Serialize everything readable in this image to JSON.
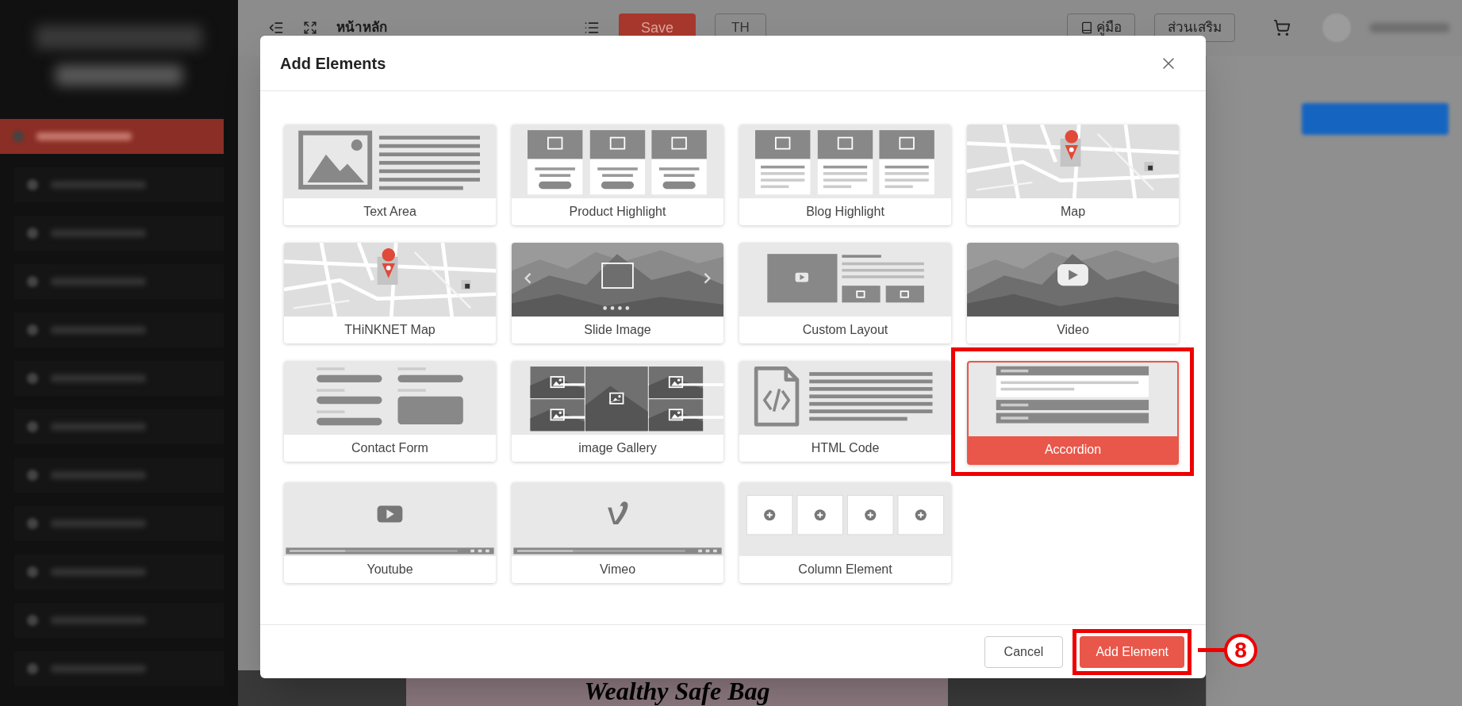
{
  "topbar": {
    "page_title": "หน้าหลัก",
    "save": "Save",
    "language": "TH",
    "manual": "คู่มือ",
    "addons": "ส่วนเสริม"
  },
  "sidebar": {
    "items": [
      {
        "selected": true
      },
      {
        "selected": false
      },
      {
        "selected": false
      },
      {
        "selected": false
      },
      {
        "selected": false
      },
      {
        "selected": false
      },
      {
        "selected": false
      },
      {
        "selected": false
      },
      {
        "selected": false
      },
      {
        "selected": false
      },
      {
        "selected": false
      },
      {
        "selected": false
      }
    ]
  },
  "canvas": {
    "banner": "Wealthy Safe Bag"
  },
  "modal": {
    "title": "Add Elements",
    "elements": [
      {
        "label": "Text Area",
        "kind": "text-area",
        "selected": false
      },
      {
        "label": "Product Highlight",
        "kind": "product-highlight",
        "selected": false
      },
      {
        "label": "Blog Highlight",
        "kind": "blog-highlight",
        "selected": false
      },
      {
        "label": "Map",
        "kind": "map",
        "selected": false
      },
      {
        "label": "THiNKNET Map",
        "kind": "map",
        "selected": false
      },
      {
        "label": "Slide Image",
        "kind": "slide",
        "selected": false
      },
      {
        "label": "Custom Layout",
        "kind": "custom-layout",
        "selected": false
      },
      {
        "label": "Video",
        "kind": "video",
        "selected": false
      },
      {
        "label": "Contact Form",
        "kind": "contact-form",
        "selected": false
      },
      {
        "label": "image Gallery",
        "kind": "gallery",
        "selected": false
      },
      {
        "label": "HTML Code",
        "kind": "html-code",
        "selected": false
      },
      {
        "label": "Accordion",
        "kind": "accordion",
        "selected": true
      },
      {
        "label": "Youtube",
        "kind": "youtube",
        "selected": false
      },
      {
        "label": "Vimeo",
        "kind": "vimeo",
        "selected": false
      },
      {
        "label": "Column Element",
        "kind": "column",
        "selected": false
      }
    ],
    "cancel": "Cancel",
    "add": "Add Element"
  },
  "callout": {
    "number": "8"
  }
}
